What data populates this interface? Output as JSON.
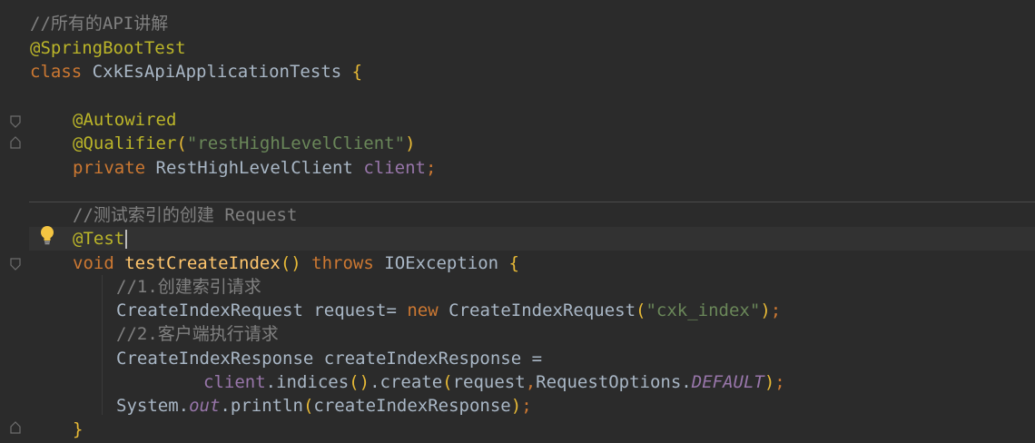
{
  "code": {
    "l1": {
      "comment": "//所有的API讲解"
    },
    "l2": {
      "annotation": "@SpringBootTest"
    },
    "l3": {
      "kw": "class",
      "name": "CxkEsApiApplicationTests",
      "brace": "{"
    },
    "l5": {
      "annotation": "@Autowired"
    },
    "l6": {
      "annotation": "@Qualifier",
      "open": "(",
      "string": "\"restHighLevelClient\"",
      "close": ")"
    },
    "l7": {
      "kw": "private",
      "type": "RestHighLevelClient",
      "field": "client",
      "semi": ";"
    },
    "l9": {
      "comment": "//测试索引的创建 Request"
    },
    "l10": {
      "annotation": "@Test"
    },
    "l11": {
      "kw": "void",
      "method": "testCreateIndex",
      "parens": "()",
      "throws": "throws",
      "exc": "IOException",
      "brace": "{"
    },
    "l12": {
      "comment": "//1.创建索引请求"
    },
    "l13": {
      "type": "CreateIndexRequest",
      "var": "request",
      "eq": "=",
      "kw": "new",
      "ctor": "CreateIndexRequest",
      "open": "(",
      "string": "\"cxk_index\"",
      "close": ")",
      "semi": ";"
    },
    "l14": {
      "comment": "//2.客户端执行请求"
    },
    "l15": {
      "type": "CreateIndexResponse",
      "var": "createIndexResponse",
      "eq": "="
    },
    "l16": {
      "field": "client",
      "dot1": ".",
      "m1": "indices",
      "p1": "()",
      "dot2": ".",
      "m2": "create",
      "open": "(",
      "arg1": "request",
      "comma": ",",
      "cls": "RequestOptions",
      "dot3": ".",
      "const": "DEFAULT",
      "close": ")",
      "semi": ";"
    },
    "l17": {
      "cls": "System",
      "dot1": ".",
      "static": "out",
      "dot2": ".",
      "m": "println",
      "open": "(",
      "arg": "createIndexResponse",
      "close": ")",
      "semi": ";"
    },
    "l18": {
      "brace": "}"
    }
  }
}
